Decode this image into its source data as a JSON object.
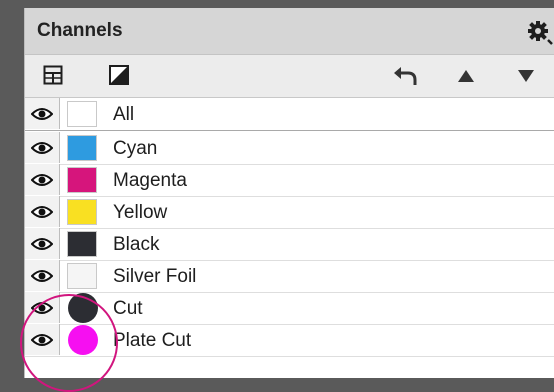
{
  "panel": {
    "title": "Channels",
    "gear_icon": "gear-icon",
    "toolbar": {
      "split_channels_icon": "grid-icon",
      "invert_icon": "contrast-icon",
      "undo_icon": "undo-arrow-icon",
      "move_up_icon": "triangle-up-icon",
      "move_down_icon": "triangle-down-icon"
    },
    "channels": [
      {
        "label": "All",
        "color": "#ffffff",
        "shape": "square"
      },
      {
        "label": "Cyan",
        "color": "#2e9be0",
        "shape": "square"
      },
      {
        "label": "Magenta",
        "color": "#d6157c",
        "shape": "square"
      },
      {
        "label": "Yellow",
        "color": "#f9e022",
        "shape": "square"
      },
      {
        "label": "Black",
        "color": "#2c2d33",
        "shape": "square"
      },
      {
        "label": "Silver Foil",
        "color": "#f5f5f5",
        "shape": "square"
      },
      {
        "label": "Cut",
        "color": "#2c2d33",
        "shape": "circle"
      },
      {
        "label": "Plate Cut",
        "color": "#f60ff1",
        "shape": "circle"
      }
    ],
    "accent_color": "#d1157e"
  }
}
